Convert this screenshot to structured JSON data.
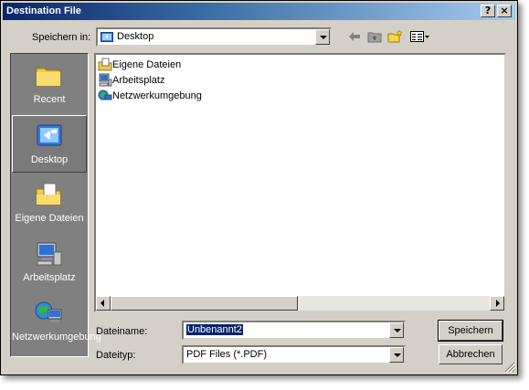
{
  "window": {
    "title": "Destination File",
    "help_label": "?",
    "close_label": "×"
  },
  "top": {
    "save_in_label": "Speichern in:",
    "location": "Desktop"
  },
  "places": [
    {
      "label": "Recent",
      "icon": "recent-folder-icon"
    },
    {
      "label": "Desktop",
      "icon": "desktop-icon",
      "selected": true
    },
    {
      "label": "Eigene Dateien",
      "icon": "my-documents-icon"
    },
    {
      "label": "Arbeitsplatz",
      "icon": "my-computer-icon"
    },
    {
      "label": "Netzwerkumgebung",
      "icon": "network-icon"
    }
  ],
  "files": [
    {
      "name": "Eigene Dateien",
      "icon": "my-documents-icon"
    },
    {
      "name": "Arbeitsplatz",
      "icon": "my-computer-icon"
    },
    {
      "name": "Netzwerkumgebung",
      "icon": "network-icon"
    }
  ],
  "form": {
    "filename_label": "Dateiname:",
    "filename_value": "Unbenannt2",
    "filetype_label": "Dateityp:",
    "filetype_value": "PDF Files (*.PDF)"
  },
  "buttons": {
    "save": "Speichern",
    "cancel": "Abbrechen"
  }
}
